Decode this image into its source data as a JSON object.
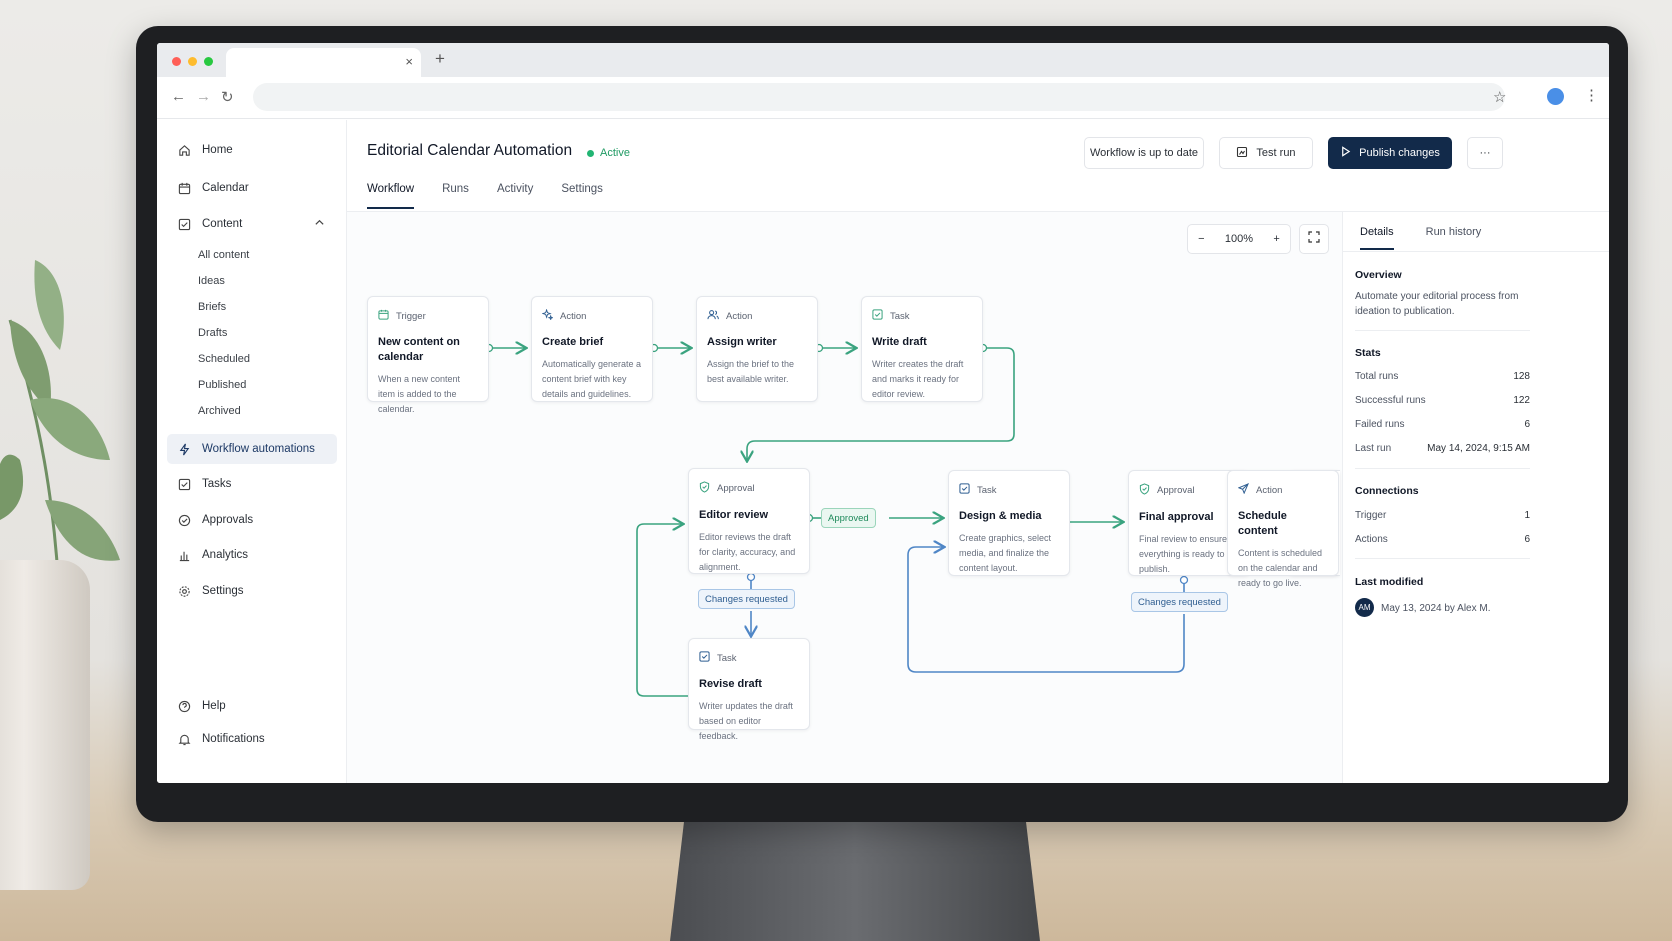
{
  "browser": {
    "tab_close": "×",
    "new_tab": "+"
  },
  "sidebar": {
    "items": [
      {
        "label": "Home"
      },
      {
        "label": "Calendar"
      },
      {
        "label": "Content"
      },
      {
        "label": "Workflow automations"
      },
      {
        "label": "Tasks"
      },
      {
        "label": "Approvals"
      },
      {
        "label": "Analytics"
      },
      {
        "label": "Settings"
      }
    ],
    "content_sub": [
      "All content",
      "Ideas",
      "Briefs",
      "Drafts",
      "Scheduled",
      "Published",
      "Archived"
    ],
    "footer": [
      {
        "label": "Help"
      },
      {
        "label": "Notifications"
      }
    ]
  },
  "header": {
    "title": "Editorial Calendar Automation",
    "status": "Active",
    "save_state": "Workflow is up to date",
    "test_run": "Test run",
    "publish": "Publish changes",
    "more": "···"
  },
  "tabs": [
    "Workflow",
    "Runs",
    "Activity",
    "Settings"
  ],
  "canvas": {
    "zoom": "100%",
    "zoom_out": "−",
    "zoom_in": "+"
  },
  "nodes": [
    {
      "kind": "Trigger",
      "name": "New content on calendar",
      "desc": "When a new content item is added to the calendar."
    },
    {
      "kind": "Action",
      "name": "Create brief",
      "desc": "Automatically generate a content brief with key details and guidelines."
    },
    {
      "kind": "Action",
      "name": "Assign writer",
      "desc": "Assign the brief to the best available writer."
    },
    {
      "kind": "Task",
      "name": "Write draft",
      "desc": "Writer creates the draft and marks it ready for editor review."
    },
    {
      "kind": "Approval",
      "name": "Editor review",
      "desc": "Editor reviews the draft for clarity, accuracy, and alignment."
    },
    {
      "kind": "Task",
      "name": "Design & media",
      "desc": "Create graphics, select media, and finalize the content layout."
    },
    {
      "kind": "Approval",
      "name": "Final approval",
      "desc": "Final review to ensure everything is ready to publish."
    },
    {
      "kind": "Action",
      "name": "Schedule content",
      "desc": "Content is scheduled on the calendar and ready to go live."
    },
    {
      "kind": "Task",
      "name": "Revise draft",
      "desc": "Writer updates the draft based on editor feedback."
    }
  ],
  "edge_labels": {
    "approved": "Approved",
    "changes_1": "Changes requested",
    "changes_2": "Changes requested"
  },
  "panel": {
    "tabs": [
      "Details",
      "Run history"
    ],
    "overview_h": "Overview",
    "overview": "Automate your editorial process from ideation to publication.",
    "stats_h": "Stats",
    "stats": [
      {
        "label": "Total runs",
        "value": "128"
      },
      {
        "label": "Successful runs",
        "value": "122"
      },
      {
        "label": "Failed runs",
        "value": "6"
      },
      {
        "label": "Last run",
        "value": "May 14, 2024, 9:15 AM"
      }
    ],
    "connections_h": "Connections",
    "connections": [
      {
        "label": "Trigger",
        "value": "1"
      },
      {
        "label": "Actions",
        "value": "6"
      }
    ],
    "modified_h": "Last modified",
    "initials": "AM",
    "modified": "May 13, 2024 by Alex M."
  },
  "colors": {
    "accent": "#122a4a",
    "active_green": "#22b573",
    "edge_green": "#3aa37f",
    "edge_blue": "#4f86c6"
  }
}
